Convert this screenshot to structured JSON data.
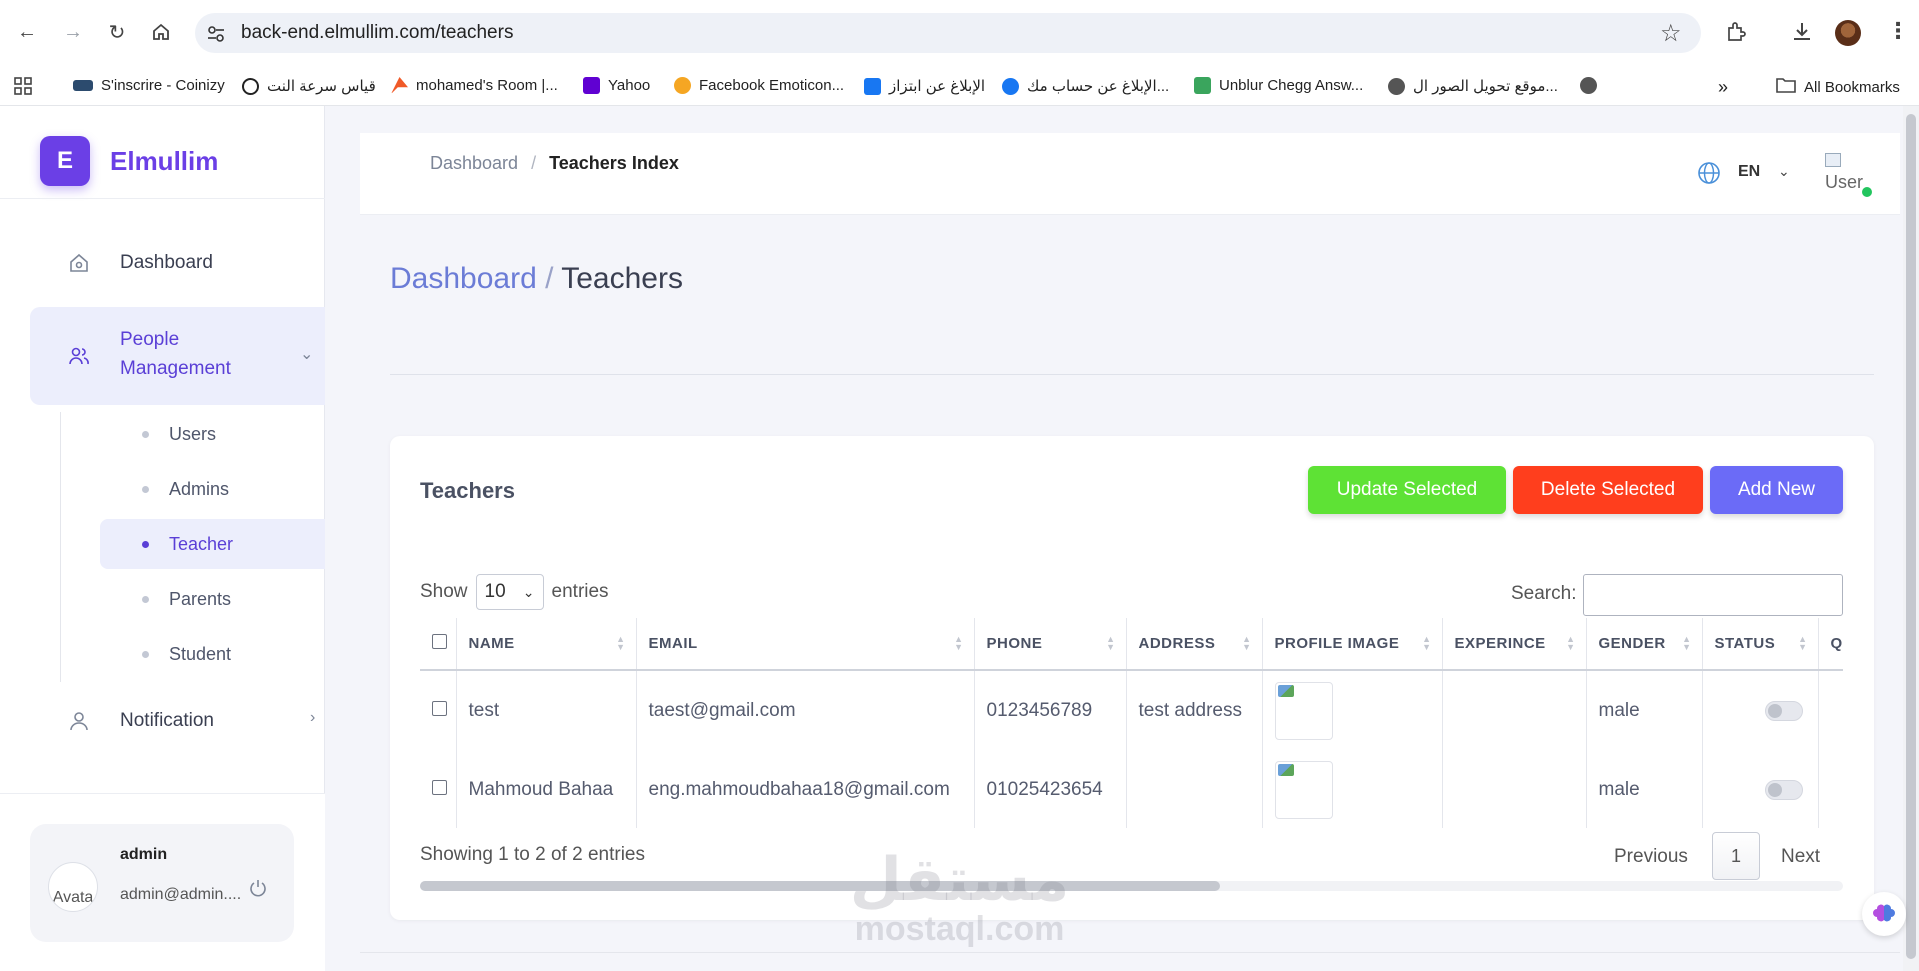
{
  "browser": {
    "url": "back-end.elmullim.com/teachers",
    "bookmarks": [
      {
        "label": "S'inscrire - Coinizy",
        "color": "#2c4b6e"
      },
      {
        "label": "قياس سرعة النت",
        "color": "#222222"
      },
      {
        "label": "mohamed's Room |...",
        "color": "#f05a28"
      },
      {
        "label": "Yahoo",
        "color": "#6001d2"
      },
      {
        "label": "Facebook Emoticon...",
        "color": "#f5a623"
      },
      {
        "label": "الإبلاغ عن ابتزاز",
        "color": "#1877f2"
      },
      {
        "label": "الإبلاغ عن حساب مك...",
        "color": "#1877f2"
      },
      {
        "label": "Unblur Chegg Answ...",
        "color": "#3aa55d"
      },
      {
        "label": "موقع تحويل الصور ال...",
        "color": "#555555"
      }
    ],
    "all_bookmarks": "All Bookmarks"
  },
  "sidebar": {
    "brand_letter": "E",
    "brand_name": "Elmullim",
    "dashboard": "Dashboard",
    "people_line1": "People",
    "people_line2": "Management",
    "sub_items": [
      "Users",
      "Admins",
      "Teacher",
      "Parents",
      "Student"
    ],
    "notification": "Notification",
    "user": {
      "name": "admin",
      "email": "admin@admin....",
      "avatar_alt": "Avata"
    }
  },
  "header": {
    "breadcrumb_root": "Dashboard",
    "breadcrumb_sep": "/",
    "breadcrumb_current": "Teachers Index",
    "lang": "EN",
    "user_alt": "User"
  },
  "page": {
    "title_root": "Dashboard",
    "title_sep": "/",
    "title_current": "Teachers"
  },
  "card": {
    "title": "Teachers",
    "update_btn": "Update Selected",
    "delete_btn": "Delete Selected",
    "add_btn": "Add New",
    "show_label": "Show",
    "page_size": "10",
    "entries_label": "entries",
    "search_label": "Search:",
    "columns": [
      "NAME",
      "EMAIL",
      "PHONE",
      "ADDRESS",
      "PROFILE IMAGE",
      "EXPERINCE",
      "GENDER",
      "STATUS",
      "Q"
    ],
    "rows": [
      {
        "name": "test",
        "email": "taest@gmail.com",
        "phone": "0123456789",
        "address": "test address",
        "experince": "",
        "gender": "male"
      },
      {
        "name": "Mahmoud Bahaa",
        "email": "eng.mahmoudbahaa18@gmail.com",
        "phone": "01025423654",
        "address": "",
        "experince": "",
        "gender": "male"
      }
    ],
    "info": "Showing 1 to 2 of 2 entries",
    "prev": "Previous",
    "page_number": "1",
    "next": "Next"
  },
  "watermark": {
    "arabic": "مستقل",
    "latin": "mostaql.com"
  }
}
